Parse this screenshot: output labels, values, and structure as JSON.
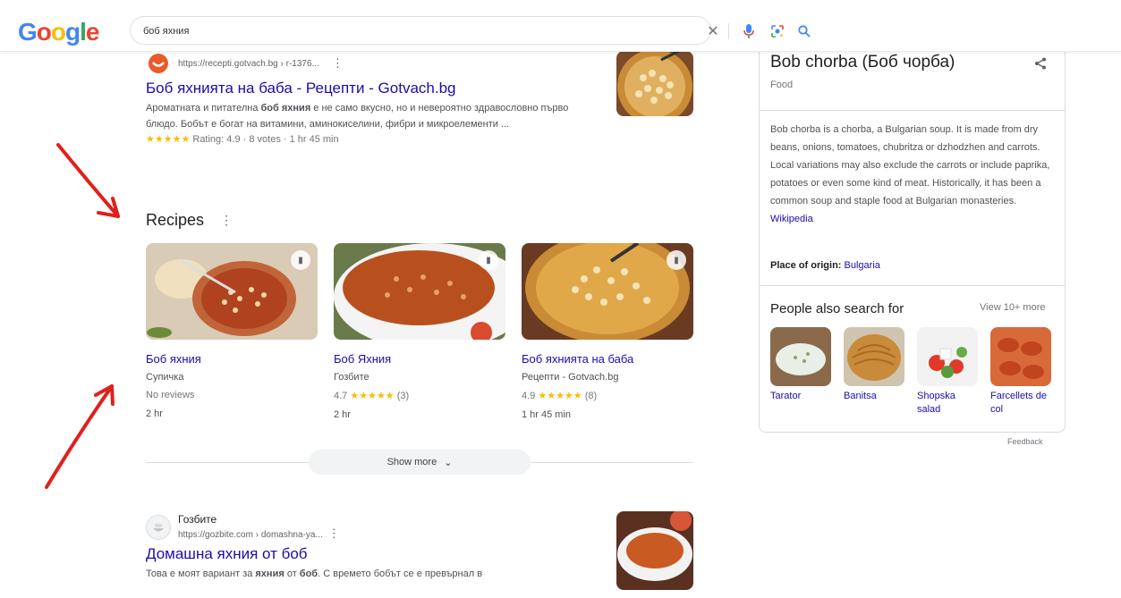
{
  "logo": "Google",
  "search": {
    "query": "боб яхния"
  },
  "result1": {
    "url": "https://recepti.gotvach.bg › r-1376...",
    "title": "Боб яхнията на баба - Рецепти - Gotvach.bg",
    "snippet_pre": "Ароматната и питателна ",
    "snippet_bold": "боб яхния",
    "snippet_post": " е не само вкусно, но и невероятно здравословно първо блюдо. Бобът е богат на витамини, аминокиселини, фибри и микроелементи ...",
    "stars": "★★★★★",
    "rating": "Rating: 4.9 · 8 votes · 1 hr 45 min"
  },
  "recipes": {
    "heading": "Recipes",
    "cards": [
      {
        "title": "Боб яхния",
        "source": "Супичка",
        "rating_value": "",
        "stars": "",
        "rating_extra": "No reviews",
        "time": "2 hr"
      },
      {
        "title": "Боб Яхния",
        "source": "Гозбите",
        "rating_value": "4.7",
        "stars": "★★★★★",
        "rating_extra": "(3)",
        "time": "2 hr"
      },
      {
        "title": "Боб яхнията на баба",
        "source": "Рецепти - Gotvach.bg",
        "rating_value": "4.9",
        "stars": "★★★★★",
        "rating_extra": "(8)",
        "time": "1 hr 45 min"
      }
    ],
    "show_more": "Show more"
  },
  "result2": {
    "site": "Гозбите",
    "url": "https://gozbite.com › domashna-ya...",
    "title": "Домашна яхния от боб",
    "snippet_a": "Това е моят вариант за ",
    "snippet_b": "яхния",
    "snippet_c": " от ",
    "snippet_d": "боб",
    "snippet_e": ". С времето бобът се е превърнал в"
  },
  "knowledge_panel": {
    "title": "Bob chorba (Боб чорба)",
    "type": "Food",
    "description": "Bob chorba is a chorba, a Bulgarian soup. It is made from dry beans, onions, tomatoes, chubritza or dzhodzhen and carrots. Local variations may also exclude the carrots or include paprika, potatoes or even some kind of meat. Historically, it has been a common soup and staple food at Bulgarian monasteries. ",
    "source_link": "Wikipedia",
    "fact_label": "Place of origin:",
    "fact_value": "Bulgaria",
    "people_also_search": "People also search for",
    "view_more": "View 10+ more",
    "items": [
      "Tarator",
      "Banitsa",
      "Shopska salad",
      "Farcellets de col"
    ],
    "feedback": "Feedback"
  },
  "colors": {
    "link": "#1a0dab",
    "star": "#fbbc04",
    "annotation_arrow": "#e0201b"
  }
}
